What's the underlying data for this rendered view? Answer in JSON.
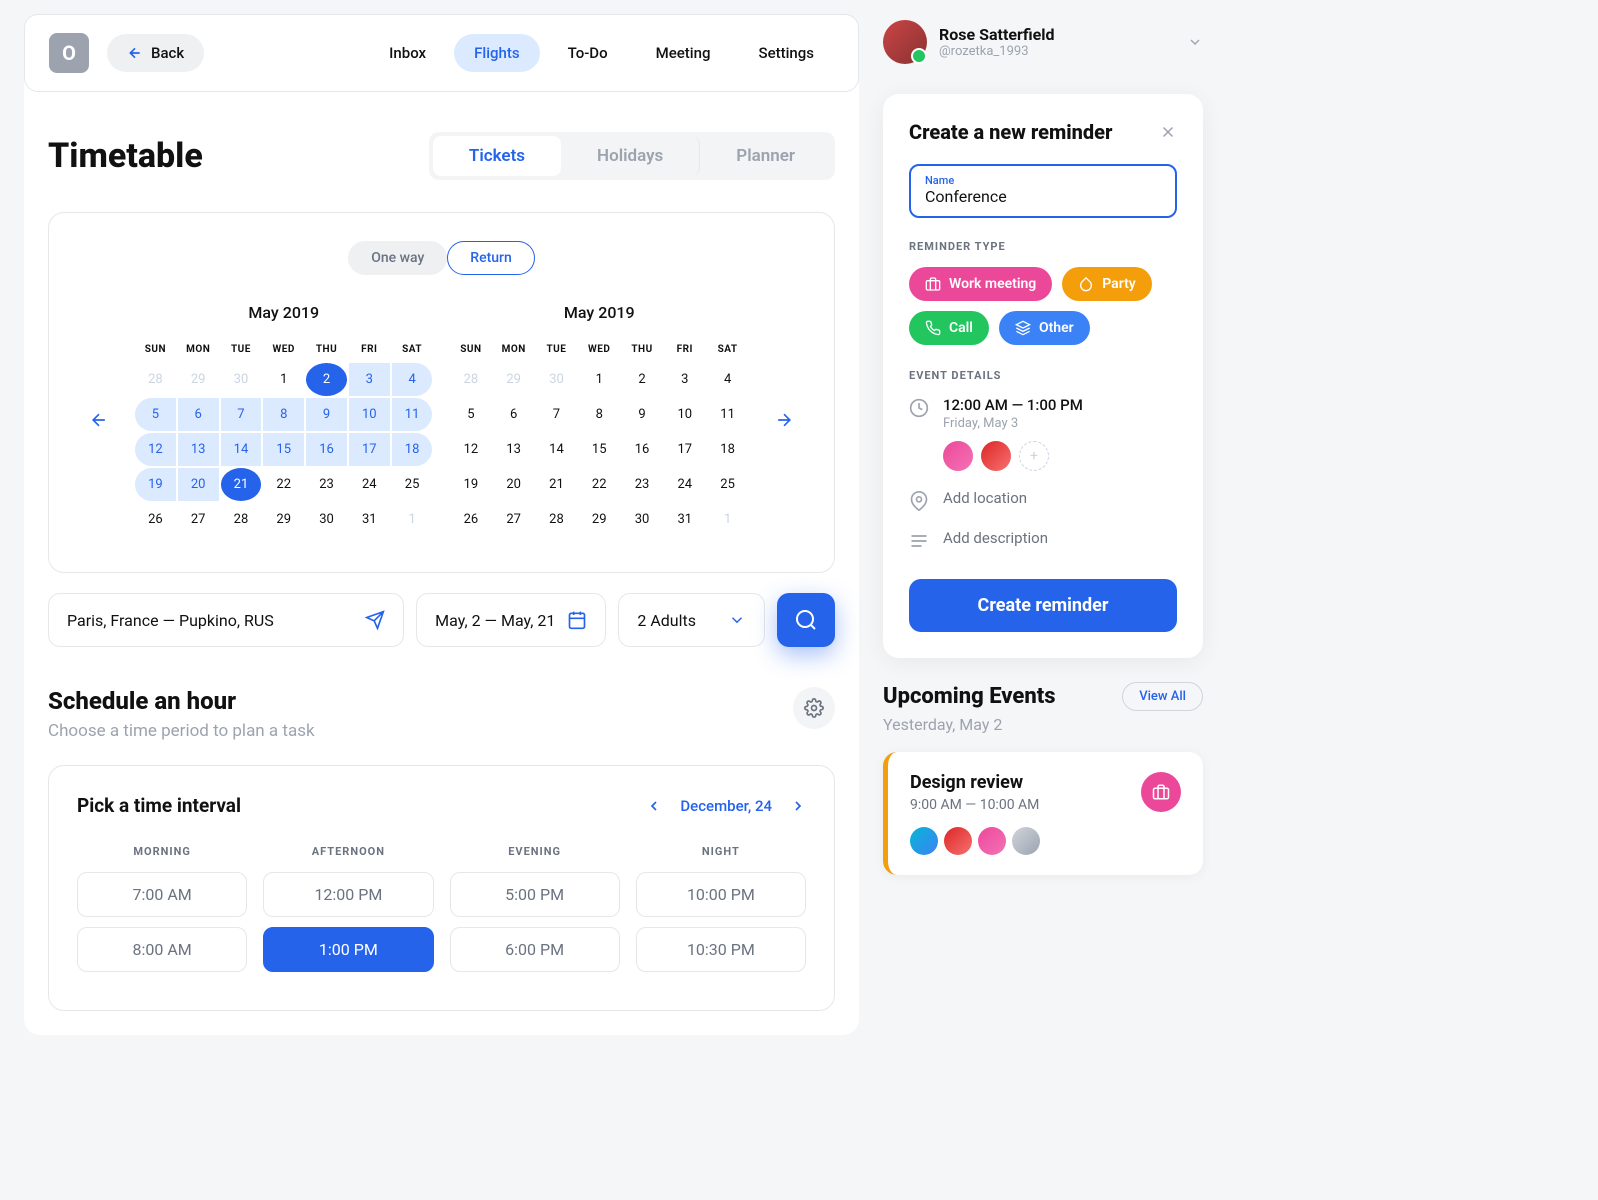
{
  "header": {
    "logo_letter": "O",
    "back_label": "Back",
    "nav": [
      "Inbox",
      "Flights",
      "To-Do",
      "Meeting",
      "Settings"
    ],
    "active_nav": "Flights"
  },
  "page_title": "Timetable",
  "segments": {
    "items": [
      "Tickets",
      "Holidays",
      "Planner"
    ],
    "active": "Tickets"
  },
  "trip": {
    "one_way": "One way",
    "return": "Return",
    "active": "Return"
  },
  "calendar": {
    "left_title": "May 2019",
    "right_title": "May 2019",
    "dow": [
      "SUN",
      "MON",
      "TUE",
      "WED",
      "THU",
      "FRI",
      "SAT"
    ],
    "left_days": [
      {
        "n": "28",
        "muted": true
      },
      {
        "n": "29",
        "muted": true
      },
      {
        "n": "30",
        "muted": true
      },
      {
        "n": "1"
      },
      {
        "n": "2",
        "selected": true,
        "range": "start"
      },
      {
        "n": "3",
        "range": "mid"
      },
      {
        "n": "4",
        "range": "end"
      },
      {
        "n": "5",
        "range": "start"
      },
      {
        "n": "6",
        "range": "mid"
      },
      {
        "n": "7",
        "range": "mid"
      },
      {
        "n": "8",
        "range": "mid"
      },
      {
        "n": "9",
        "range": "mid"
      },
      {
        "n": "10",
        "range": "mid"
      },
      {
        "n": "11",
        "range": "end"
      },
      {
        "n": "12",
        "range": "start"
      },
      {
        "n": "13",
        "range": "mid"
      },
      {
        "n": "14",
        "range": "mid"
      },
      {
        "n": "15",
        "range": "mid"
      },
      {
        "n": "16",
        "range": "mid"
      },
      {
        "n": "17",
        "range": "mid"
      },
      {
        "n": "18",
        "range": "end"
      },
      {
        "n": "19",
        "range": "start"
      },
      {
        "n": "20",
        "range": "mid"
      },
      {
        "n": "21",
        "selected": true,
        "range": "end"
      },
      {
        "n": "22"
      },
      {
        "n": "23"
      },
      {
        "n": "24"
      },
      {
        "n": "25"
      },
      {
        "n": "26"
      },
      {
        "n": "27"
      },
      {
        "n": "28"
      },
      {
        "n": "29"
      },
      {
        "n": "30"
      },
      {
        "n": "31"
      },
      {
        "n": "1",
        "muted": true
      }
    ],
    "right_days": [
      {
        "n": "28",
        "muted": true
      },
      {
        "n": "29",
        "muted": true
      },
      {
        "n": "30",
        "muted": true
      },
      {
        "n": "1"
      },
      {
        "n": "2"
      },
      {
        "n": "3"
      },
      {
        "n": "4"
      },
      {
        "n": "5"
      },
      {
        "n": "6"
      },
      {
        "n": "7"
      },
      {
        "n": "8"
      },
      {
        "n": "9"
      },
      {
        "n": "10"
      },
      {
        "n": "11"
      },
      {
        "n": "12"
      },
      {
        "n": "13"
      },
      {
        "n": "14"
      },
      {
        "n": "15"
      },
      {
        "n": "16"
      },
      {
        "n": "17"
      },
      {
        "n": "18"
      },
      {
        "n": "19"
      },
      {
        "n": "20"
      },
      {
        "n": "21"
      },
      {
        "n": "22"
      },
      {
        "n": "23"
      },
      {
        "n": "24"
      },
      {
        "n": "25"
      },
      {
        "n": "26"
      },
      {
        "n": "27"
      },
      {
        "n": "28"
      },
      {
        "n": "29"
      },
      {
        "n": "30"
      },
      {
        "n": "31"
      },
      {
        "n": "1",
        "muted": true
      }
    ]
  },
  "search": {
    "route": "Paris, France — Pupkino, RUS",
    "dates": "May, 2 — May, 21",
    "pax": "2 Adults"
  },
  "schedule": {
    "title": "Schedule an hour",
    "subtitle": "Choose a time period to plan a task"
  },
  "time": {
    "title": "Pick a time interval",
    "date_label": "December, 24",
    "cols": [
      {
        "head": "MORNING",
        "slots": [
          "7:00 AM",
          "8:00 AM"
        ]
      },
      {
        "head": "AFTERNOON",
        "slots": [
          "12:00 PM",
          "1:00 PM"
        ]
      },
      {
        "head": "EVENING",
        "slots": [
          "5:00 PM",
          "6:00 PM"
        ]
      },
      {
        "head": "NIGHT",
        "slots": [
          "10:00 PM",
          "10:30 PM"
        ]
      }
    ],
    "selected": "1:00 PM"
  },
  "user": {
    "name": "Rose Satterfield",
    "handle": "@rozetka_1993"
  },
  "reminder": {
    "title": "Create a new reminder",
    "name_label": "Name",
    "name_value": "Conference",
    "type_label": "REMINDER TYPE",
    "types": [
      {
        "label": "Work meeting",
        "color": "pink"
      },
      {
        "label": "Party",
        "color": "yellow"
      },
      {
        "label": "Call",
        "color": "green"
      },
      {
        "label": "Other",
        "color": "blue"
      }
    ],
    "details_label": "EVENT DETAILS",
    "time_text": "12:00 AM — 1:00 PM",
    "time_sub": "Friday, May 3",
    "add_location": "Add location",
    "add_description": "Add description",
    "submit": "Create reminder"
  },
  "events": {
    "title": "Upcoming Events",
    "view_all": "View All",
    "subtitle": "Yesterday, May 2",
    "item": {
      "title": "Design review",
      "time": "9:00 AM — 10:00 AM"
    }
  }
}
